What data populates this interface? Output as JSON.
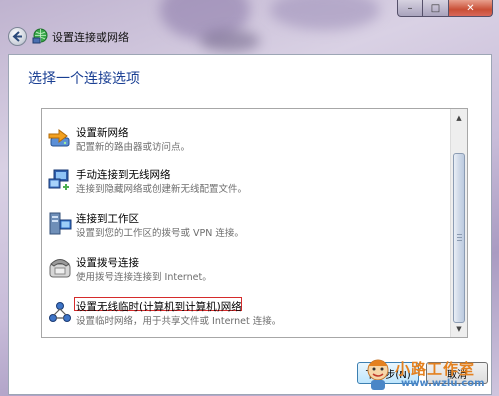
{
  "window": {
    "title": "设置连接或网络",
    "controls": {
      "minimize": "–",
      "maximize": "□",
      "close": "✕"
    }
  },
  "main": {
    "heading": "选择一个连接选项",
    "options": [
      {
        "title": "设置新网络",
        "desc": "配置新的路由器或访问点。",
        "icon": "router-arrow-icon"
      },
      {
        "title": "手动连接到无线网络",
        "desc": "连接到隐藏网络或创建新无线配置文件。",
        "icon": "wireless-network-icon"
      },
      {
        "title": "连接到工作区",
        "desc": "设置到您的工作区的拨号或 VPN 连接。",
        "icon": "workplace-vpn-icon"
      },
      {
        "title": "设置拨号连接",
        "desc": "使用拨号连接连接到 Internet。",
        "icon": "dialup-phone-icon"
      },
      {
        "title": "设置无线临时(计算机到计算机)网络",
        "desc": "设置临时网络，用于共享文件或 Internet 连接。",
        "icon": "adhoc-network-icon"
      }
    ]
  },
  "footer": {
    "next_label": "下一步(N)",
    "cancel_label": "取消"
  },
  "watermark": {
    "text": "小路工作室",
    "url": "www.wzlu.com"
  },
  "colors": {
    "heading": "#1a3f93",
    "highlight_border": "#d52b2b",
    "frame": "#c8bcd9"
  }
}
